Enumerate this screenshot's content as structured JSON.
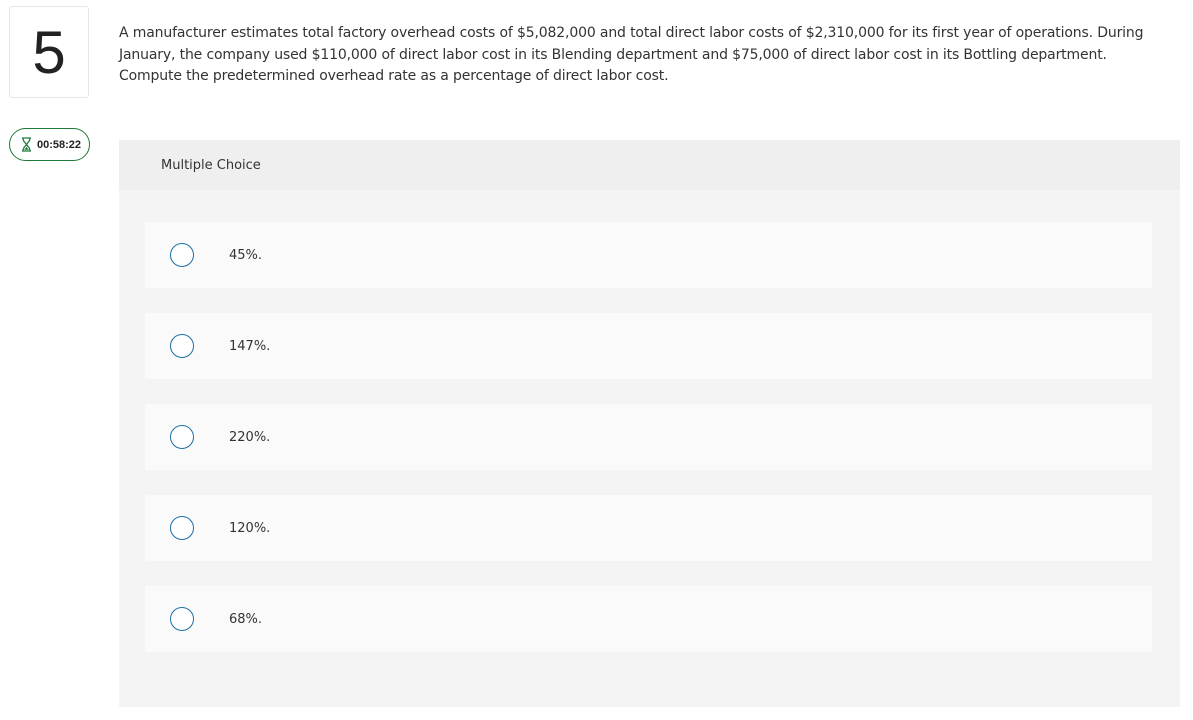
{
  "question_number": "5",
  "timer": {
    "icon": "hourglass-icon",
    "value": "00:58:22",
    "border_color": "#1f7a3a"
  },
  "question_text": "A manufacturer estimates total factory overhead costs of $5,082,000 and total direct labor costs of $2,310,000 for its first year of operations. During January, the company used $110,000 of direct labor cost in its Blending department and $75,000 of direct labor cost in its Bottling department. Compute the predetermined overhead rate as a percentage of direct labor cost.",
  "multiple_choice": {
    "header": "Multiple Choice",
    "options": [
      {
        "label": "45%."
      },
      {
        "label": "147%."
      },
      {
        "label": "220%."
      },
      {
        "label": "120%."
      },
      {
        "label": "68%."
      }
    ],
    "radio_color": "#1c6ea4"
  }
}
